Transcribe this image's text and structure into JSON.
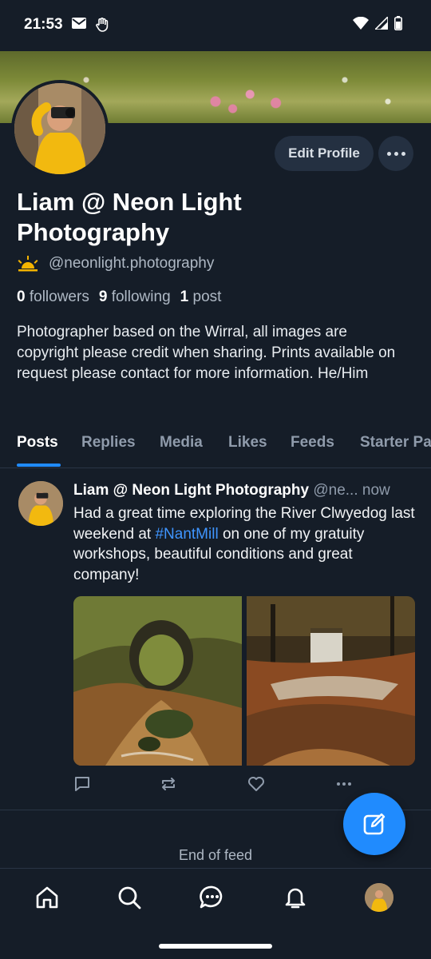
{
  "status_bar": {
    "time": "21:53",
    "icons": [
      "mail-icon",
      "hand-icon",
      "wifi-icon",
      "signal-icon",
      "battery-icon"
    ]
  },
  "profile": {
    "display_name": "Liam @ Neon Light Photography",
    "handle": "@neonlight.photography",
    "badge_icon": "sunrise-emoji-icon",
    "edit_label": "Edit Profile",
    "followers_count": "0",
    "followers_label": "followers",
    "following_count": "9",
    "following_label": "following",
    "posts_count": "1",
    "posts_label": "post",
    "bio": "Photographer based on the Wirral, all images are copyright please credit when sharing. Prints available on request please contact for more information. He/Him"
  },
  "tabs": [
    {
      "label": "Posts",
      "active": true
    },
    {
      "label": "Replies"
    },
    {
      "label": "Media"
    },
    {
      "label": "Likes"
    },
    {
      "label": "Feeds"
    },
    {
      "label": "Starter Pa"
    }
  ],
  "post": {
    "author": "Liam @ Neon Light Photography",
    "handle": "@ne...",
    "time": "now",
    "text_before": "Had a great time exploring the River Clwyedog last weekend at ",
    "hashtag": "#NantMill",
    "text_after": " on one of my gratuity workshops, beautiful conditions and great company!",
    "images": [
      "stream-bridge-image",
      "waterfall-image"
    ]
  },
  "feed": {
    "end_label": "End of feed"
  },
  "colors": {
    "background": "#151d28",
    "accent": "#208bfe",
    "muted_text": "#8f9bab"
  },
  "bottom_nav": [
    "home-icon",
    "search-icon",
    "chat-icon",
    "bell-icon",
    "profile-avatar"
  ]
}
